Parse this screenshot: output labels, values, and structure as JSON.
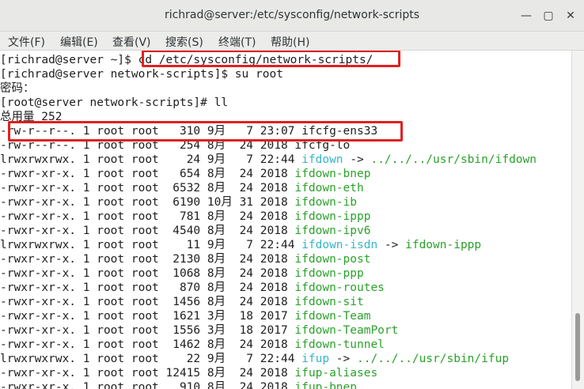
{
  "window": {
    "title": "richrad@server:/etc/sysconfig/network-scripts"
  },
  "menu": [
    "文件(F)",
    "编辑(E)",
    "查看(V)",
    "搜索(S)",
    "终端(T)",
    "帮助(H)"
  ],
  "terminal": {
    "lines": [
      {
        "parts": [
          {
            "t": "[richrad@server ~]$ cd /etc/sysconfig/network-scripts/",
            "c": ""
          }
        ]
      },
      {
        "parts": [
          {
            "t": "[richrad@server network-scripts]$ su root",
            "c": ""
          }
        ]
      },
      {
        "parts": [
          {
            "t": "密码：",
            "c": ""
          }
        ]
      },
      {
        "parts": [
          {
            "t": "[root@server network-scripts]# ll",
            "c": ""
          }
        ]
      },
      {
        "parts": [
          {
            "t": "总用量 252",
            "c": ""
          }
        ]
      },
      {
        "parts": [
          {
            "t": "-rw-r--r--. 1 root root   310 9月   7 23:07 ifcfg-ens33",
            "c": ""
          }
        ]
      },
      {
        "parts": [
          {
            "t": "-rw-r--r--. 1 root root   254 8月  24 2018 ifcfg-lo",
            "c": ""
          }
        ]
      },
      {
        "parts": [
          {
            "t": "lrwxrwxrwx. 1 root root    24 9月   7 22:44 ",
            "c": ""
          },
          {
            "t": "ifdown",
            "c": "cyanb"
          },
          {
            "t": " -> ",
            "c": ""
          },
          {
            "t": "../../../usr/sbin/ifdown",
            "c": "green"
          }
        ]
      },
      {
        "parts": [
          {
            "t": "-rwxr-xr-x. 1 root root   654 8月  24 2018 ",
            "c": ""
          },
          {
            "t": "ifdown-bnep",
            "c": "green"
          }
        ]
      },
      {
        "parts": [
          {
            "t": "-rwxr-xr-x. 1 root root  6532 8月  24 2018 ",
            "c": ""
          },
          {
            "t": "ifdown-eth",
            "c": "green"
          }
        ]
      },
      {
        "parts": [
          {
            "t": "-rwxr-xr-x. 1 root root  6190 10月 31 2018 ",
            "c": ""
          },
          {
            "t": "ifdown-ib",
            "c": "green"
          }
        ]
      },
      {
        "parts": [
          {
            "t": "-rwxr-xr-x. 1 root root   781 8月  24 2018 ",
            "c": ""
          },
          {
            "t": "ifdown-ippp",
            "c": "green"
          }
        ]
      },
      {
        "parts": [
          {
            "t": "-rwxr-xr-x. 1 root root  4540 8月  24 2018 ",
            "c": ""
          },
          {
            "t": "ifdown-ipv6",
            "c": "green"
          }
        ]
      },
      {
        "parts": [
          {
            "t": "lrwxrwxrwx. 1 root root    11 9月   7 22:44 ",
            "c": ""
          },
          {
            "t": "ifdown-isdn",
            "c": "cyanb"
          },
          {
            "t": " -> ",
            "c": ""
          },
          {
            "t": "ifdown-ippp",
            "c": "green"
          }
        ]
      },
      {
        "parts": [
          {
            "t": "-rwxr-xr-x. 1 root root  2130 8月  24 2018 ",
            "c": ""
          },
          {
            "t": "ifdown-post",
            "c": "green"
          }
        ]
      },
      {
        "parts": [
          {
            "t": "-rwxr-xr-x. 1 root root  1068 8月  24 2018 ",
            "c": ""
          },
          {
            "t": "ifdown-ppp",
            "c": "green"
          }
        ]
      },
      {
        "parts": [
          {
            "t": "-rwxr-xr-x. 1 root root   870 8月  24 2018 ",
            "c": ""
          },
          {
            "t": "ifdown-routes",
            "c": "green"
          }
        ]
      },
      {
        "parts": [
          {
            "t": "-rwxr-xr-x. 1 root root  1456 8月  24 2018 ",
            "c": ""
          },
          {
            "t": "ifdown-sit",
            "c": "green"
          }
        ]
      },
      {
        "parts": [
          {
            "t": "-rwxr-xr-x. 1 root root  1621 3月  18 2017 ",
            "c": ""
          },
          {
            "t": "ifdown-Team",
            "c": "green"
          }
        ]
      },
      {
        "parts": [
          {
            "t": "-rwxr-xr-x. 1 root root  1556 3月  18 2017 ",
            "c": ""
          },
          {
            "t": "ifdown-TeamPort",
            "c": "green"
          }
        ]
      },
      {
        "parts": [
          {
            "t": "-rwxr-xr-x. 1 root root  1462 8月  24 2018 ",
            "c": ""
          },
          {
            "t": "ifdown-tunnel",
            "c": "green"
          }
        ]
      },
      {
        "parts": [
          {
            "t": "lrwxrwxrwx. 1 root root    22 9月   7 22:44 ",
            "c": ""
          },
          {
            "t": "ifup",
            "c": "cyanb"
          },
          {
            "t": " -> ",
            "c": ""
          },
          {
            "t": "../../../usr/sbin/ifup",
            "c": "green"
          }
        ]
      },
      {
        "parts": [
          {
            "t": "-rwxr-xr-x. 1 root root 12415 8月  24 2018 ",
            "c": ""
          },
          {
            "t": "ifup-aliases",
            "c": "green"
          }
        ]
      },
      {
        "parts": [
          {
            "t": "-rwxr-xr-x. 1 root root   910 8月  24 2018 ",
            "c": ""
          },
          {
            "t": "ifup-bnep",
            "c": "green"
          }
        ]
      }
    ]
  },
  "colors": {
    "symlink": "#34b7c9",
    "executable": "#2aa22a",
    "highlight_box": "#e02020"
  }
}
